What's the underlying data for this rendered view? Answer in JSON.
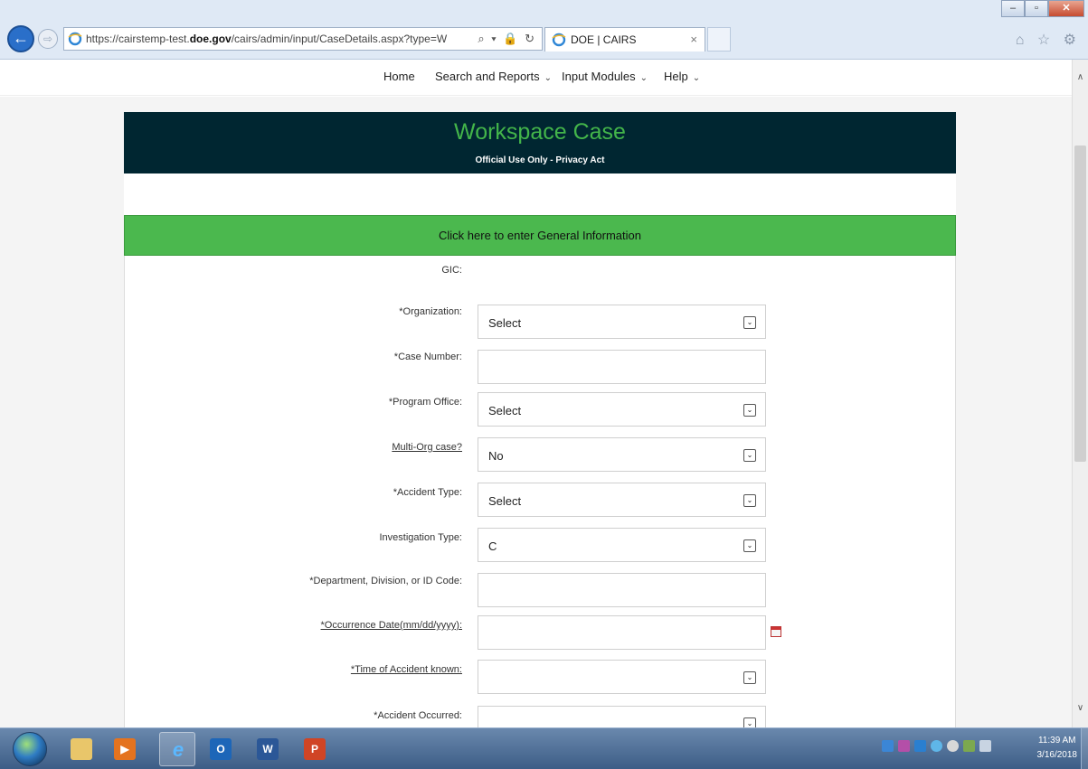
{
  "browser": {
    "url_prefix": "https://cairstemp-test.",
    "url_domain": "doe.gov",
    "url_path": "/cairs/admin/input/CaseDetails.aspx?type=W",
    "address_tools": "⌕ ▾ 🔒 ↻",
    "tab_title": "DOE | CAIRS",
    "tab_close": "×",
    "back_glyph": "←",
    "forward_glyph": "⇨",
    "window_minimize": "–",
    "window_maximize": "▫",
    "window_close": "✕",
    "toolbar_icons": "⌂ ☆ ⚙"
  },
  "nav": {
    "home": "Home",
    "search_reports": "Search and Reports",
    "input_modules": "Input Modules",
    "help": "Help",
    "chevron": "⌄"
  },
  "header": {
    "title": "Workspace Case",
    "subtitle": "Official Use Only - Privacy Act"
  },
  "general_info_button": "Click here to enter General Information",
  "form": {
    "gic_label": "GIC:",
    "fields": [
      {
        "label": "*Organization:",
        "value": "Select",
        "type": "select"
      },
      {
        "label": "*Case Number:",
        "value": "",
        "type": "text"
      },
      {
        "label": "*Program Office:",
        "value": "Select",
        "type": "select"
      },
      {
        "label": "Multi-Org case?",
        "value": "No",
        "type": "select"
      },
      {
        "label": "*Accident Type:",
        "value": "Select",
        "type": "select"
      },
      {
        "label": "Investigation Type:",
        "value": "C",
        "type": "select"
      },
      {
        "label": "*Department, Division, or ID Code:",
        "value": "",
        "type": "text"
      },
      {
        "label": "*Occurrence Date(mm/dd/yyyy):",
        "value": "",
        "type": "date"
      },
      {
        "label": "*Time of Accident known:",
        "value": "",
        "type": "select"
      },
      {
        "label": "*Accident Occurred:",
        "value": "",
        "type": "select"
      }
    ],
    "dropdown_glyph": "⌄"
  },
  "scrollbar": {
    "up": "∧",
    "down": "∨"
  },
  "taskbar": {
    "clock_time": "11:39 AM",
    "clock_date": "3/16/2018",
    "outlook_glyph": "O",
    "word_glyph": "W",
    "powerpoint_glyph": "P",
    "ie_glyph": "e"
  }
}
